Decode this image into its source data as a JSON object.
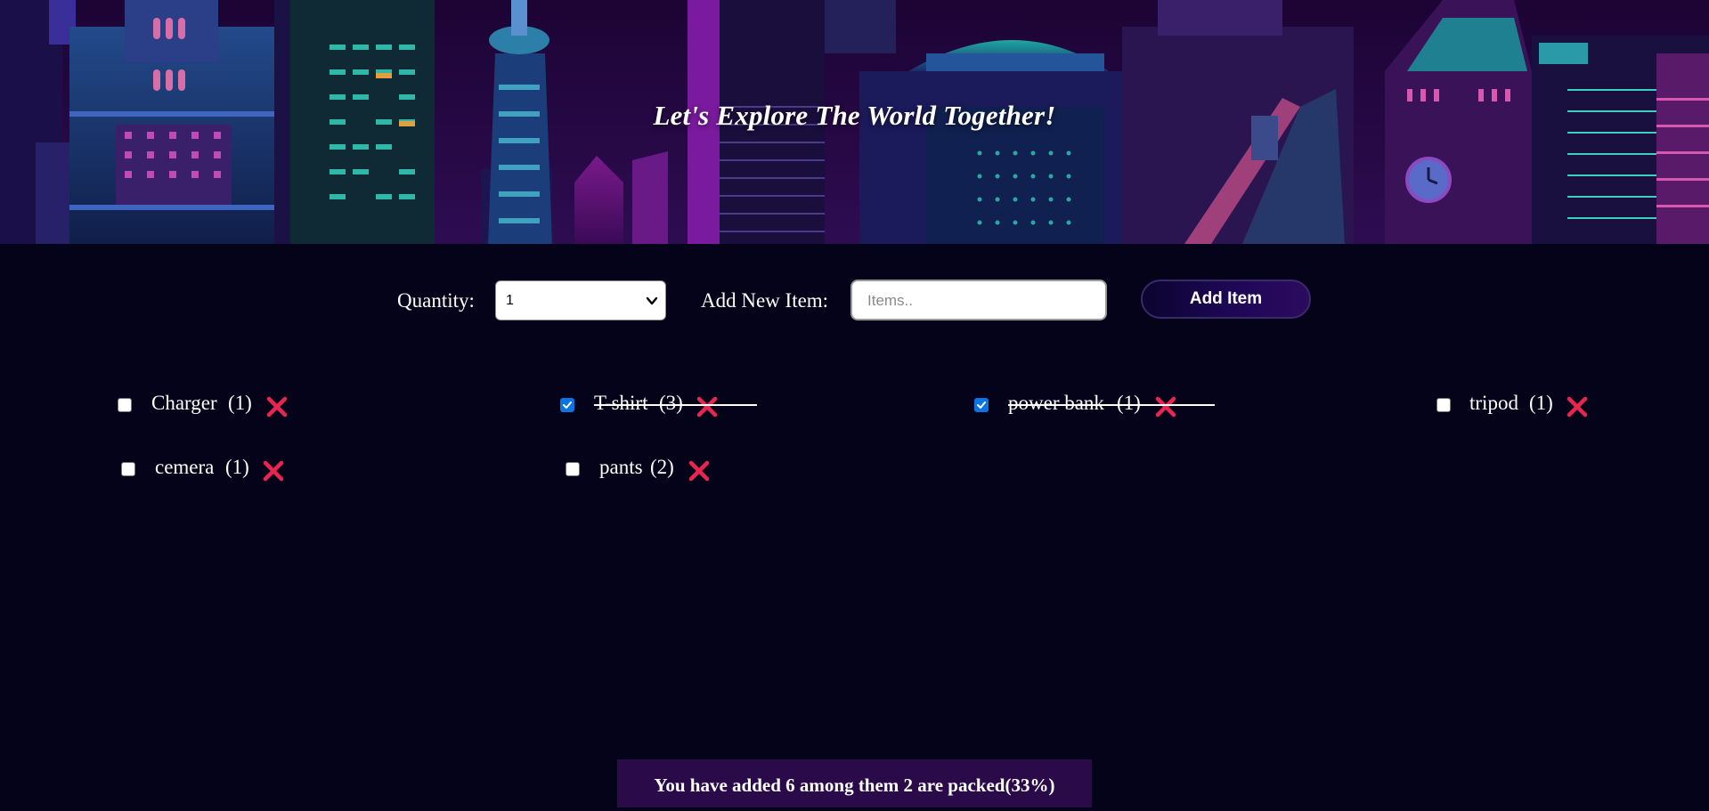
{
  "hero": {
    "title": "Let's Explore The World Together!"
  },
  "form": {
    "quantity_label": "Quantity:",
    "quantity_value": "1",
    "new_item_label": "Add New Item:",
    "new_item_placeholder": "Items..",
    "new_item_value": "",
    "add_button_label": "Add Item"
  },
  "items": [
    {
      "name": "Charger",
      "count": "(1)",
      "packed": false
    },
    {
      "name": "T-shirt",
      "count": "(3)",
      "packed": true
    },
    {
      "name": "power bank",
      "count": "(1)",
      "packed": true
    },
    {
      "name": "tripod",
      "count": "(1)",
      "packed": false
    },
    {
      "name": "cemera",
      "count": "(1)",
      "packed": false
    },
    {
      "name": "pants",
      "count": "(2)",
      "packed": false
    }
  ],
  "stats": {
    "text": "You have added 6 among them 2 are packed(33%)"
  },
  "icons": {
    "remove": "close-x-icon",
    "dropdown": "chevron-down-icon",
    "checkbox": "checkmark-icon"
  },
  "colors": {
    "background": "#04031a",
    "remove_icon": "#e8264f",
    "checkbox_checked": "#0b74e5",
    "stats_bg": "#2a0a48"
  }
}
